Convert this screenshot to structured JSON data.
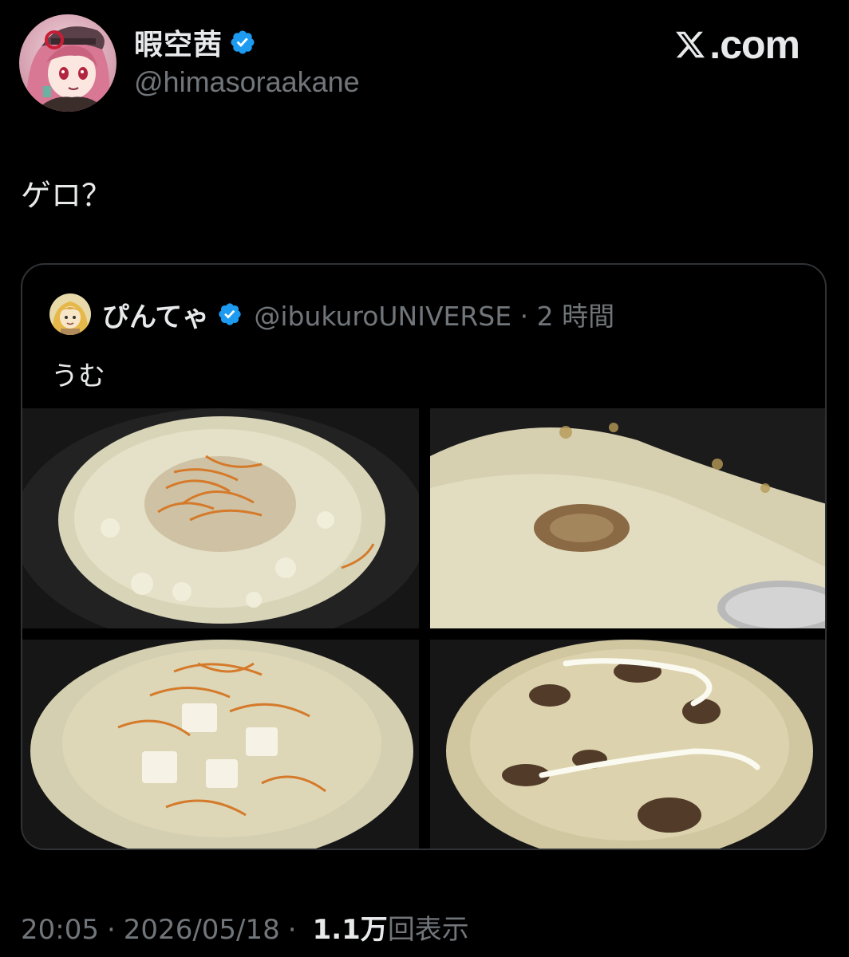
{
  "author": {
    "display_name": "暇空茜",
    "handle": "@himasoraakane",
    "verified_icon": "verified-badge-icon"
  },
  "brand": {
    "label": ".com",
    "logo_icon": "x-logo-icon"
  },
  "tweet": {
    "text": "ゲロ？"
  },
  "quote": {
    "display_name": "ぴんてゃ",
    "handle_and_time": "@ibukuroUNIVERSE · 2 時間",
    "text": "うむ",
    "images": [
      {
        "name": "photo-1",
        "description_icon": "photo-icon"
      },
      {
        "name": "photo-2",
        "description_icon": "photo-icon"
      },
      {
        "name": "photo-3",
        "description_icon": "photo-icon"
      },
      {
        "name": "photo-4",
        "description_icon": "photo-icon"
      }
    ]
  },
  "footer": {
    "time": "20:05",
    "date": "2026/05/18",
    "views_count": "1.1万",
    "views_label": "回表示",
    "separator": "·"
  },
  "colors": {
    "background": "#000000",
    "text_primary": "#e7e9ea",
    "text_secondary": "#71767b",
    "verified_blue": "#1d9bf0",
    "border": "#2f3336"
  }
}
